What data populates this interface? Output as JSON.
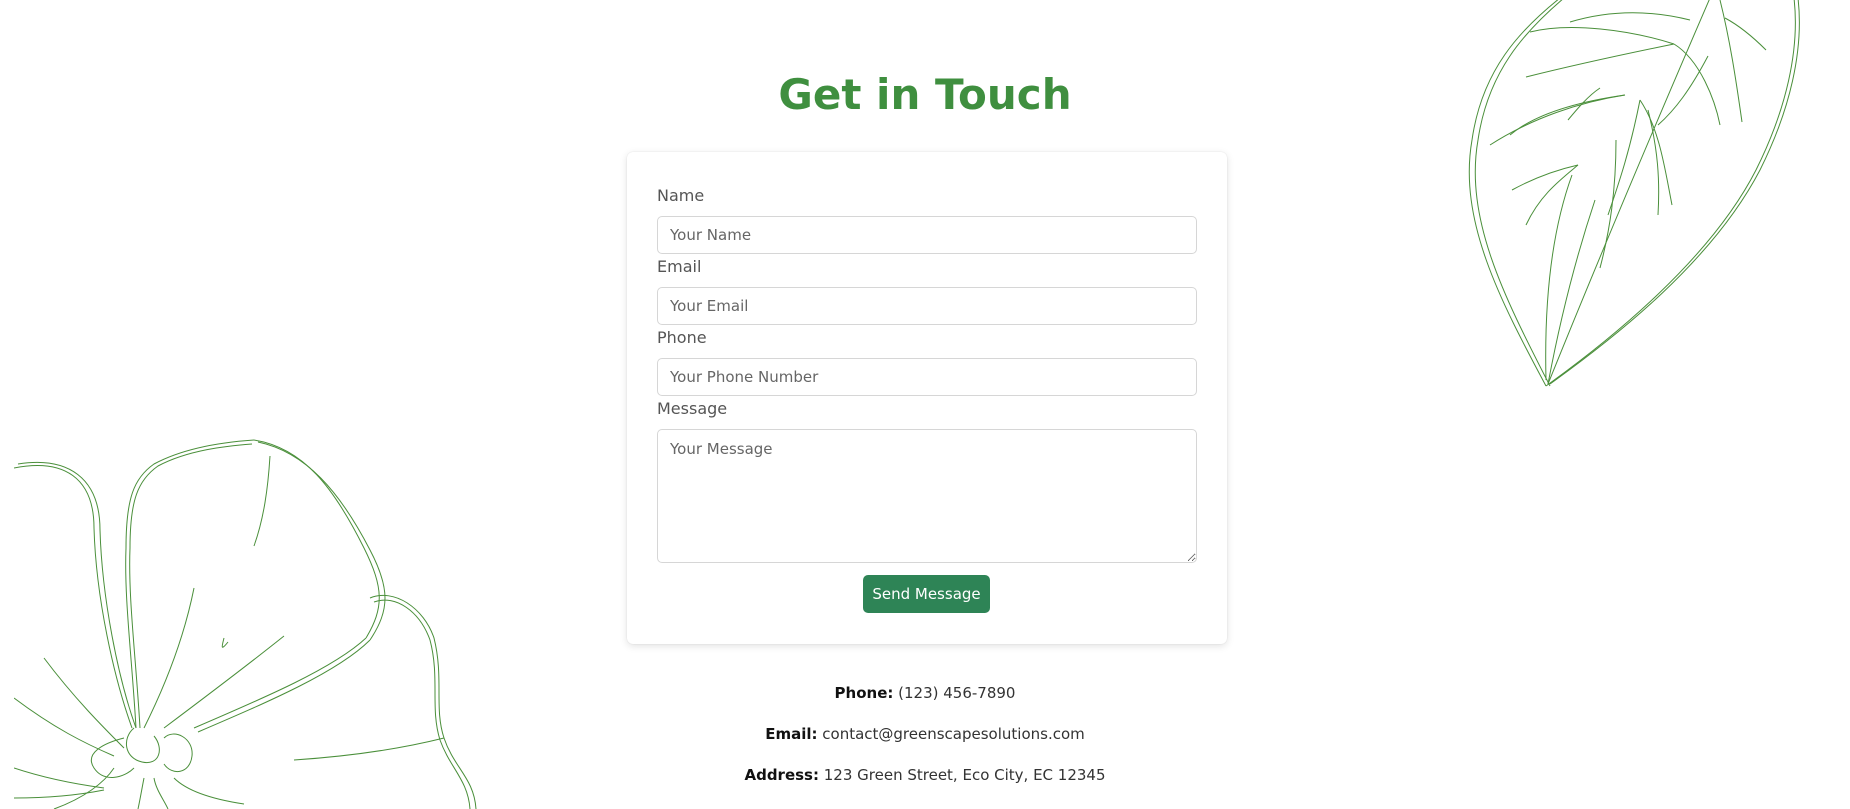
{
  "title": "Get in Touch",
  "form": {
    "name_label": "Name",
    "name_placeholder": "Your Name",
    "email_label": "Email",
    "email_placeholder": "Your Email",
    "phone_label": "Phone",
    "phone_placeholder": "Your Phone Number",
    "message_label": "Message",
    "message_placeholder": "Your Message",
    "submit_label": "Send Message"
  },
  "contact": {
    "phone_label": "Phone:",
    "phone_value": "(123) 456-7890",
    "email_label": "Email:",
    "email_value": "contact@greenscapesolutions.com",
    "address_label": "Address:",
    "address_value": "123 Green Street, Eco City, EC 12345"
  },
  "colors": {
    "accent": "#3f8f3f",
    "button": "#2e8456",
    "line_art": "#4a8f3a"
  },
  "decorations": {
    "top_right": "leaf-line-art-icon",
    "bottom_left": "flower-line-art-icon"
  }
}
